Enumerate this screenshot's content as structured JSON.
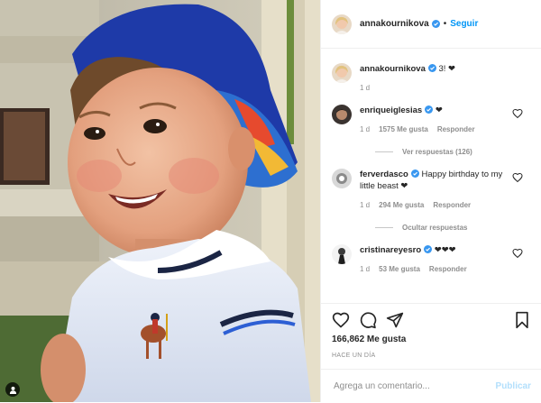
{
  "post": {
    "author": "annakournikova",
    "follow_label": "Seguir",
    "dot": "•",
    "image_alt": "photo-of-smiling-child-in-blue-cap"
  },
  "caption": {
    "user": "annakournikova",
    "text": "3! ❤",
    "time": "1 d"
  },
  "comments": [
    {
      "user": "enriqueiglesias",
      "text": "❤",
      "time": "1 d",
      "likes": "1575 Me gusta",
      "reply": "Responder",
      "replies_label": "Ver respuestas (126)"
    },
    {
      "user": "ferverdasco",
      "text": "Happy birthday to my little beast ❤",
      "time": "1 d",
      "likes": "294 Me gusta",
      "reply": "Responder",
      "replies_label": "Ocultar respuestas"
    },
    {
      "user": "cristinareyesro",
      "text": "❤❤❤",
      "time": "1 d",
      "likes": "53 Me gusta",
      "reply": "Responder"
    }
  ],
  "actions": {
    "likes_count": "166,862 Me gusta",
    "time_ago": "HACE UN DÍA",
    "comment_placeholder": "Agrega un comentario...",
    "publish_label": "Publicar"
  },
  "colors": {
    "link_blue": "#0095f6",
    "publish_disabled": "#b2dffc",
    "muted": "#8e8e8e",
    "verified": "#3897f0"
  },
  "icons": [
    "heart-icon",
    "comment-icon",
    "share-icon",
    "bookmark-icon",
    "verified-icon"
  ]
}
